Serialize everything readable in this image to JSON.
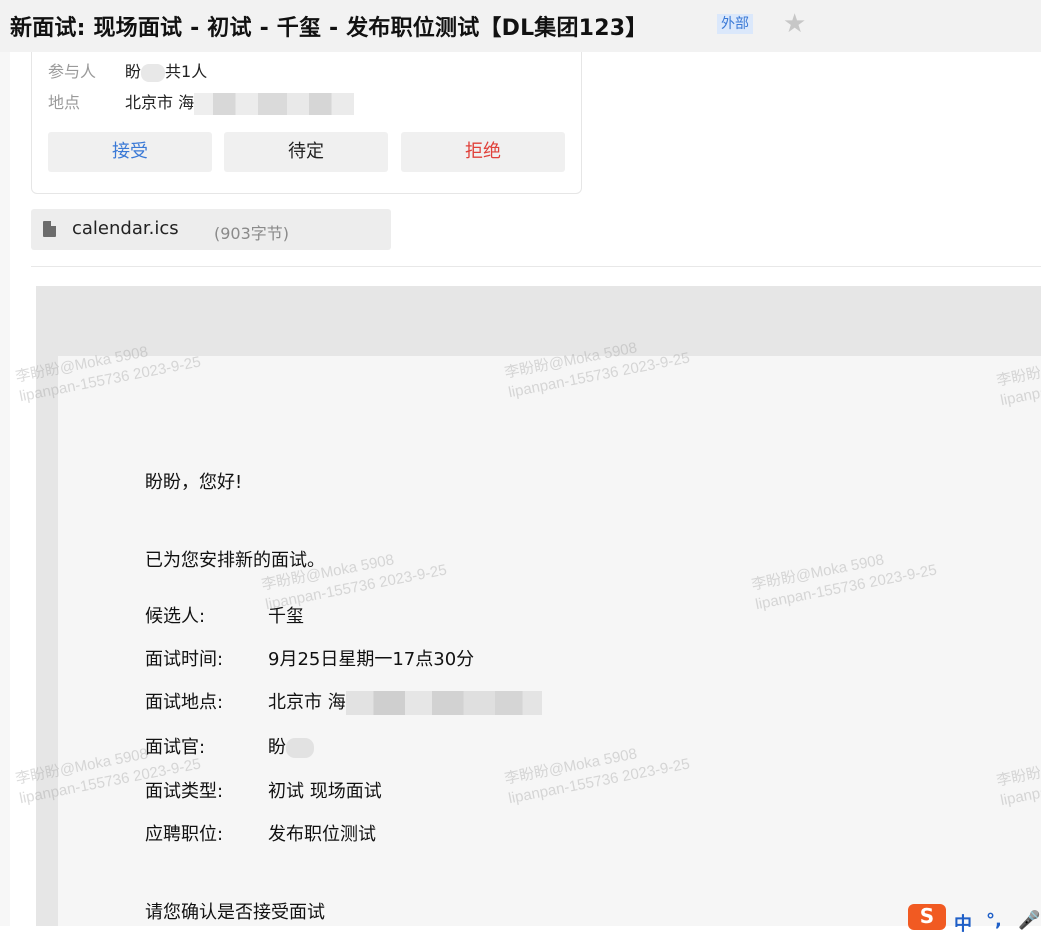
{
  "header": {
    "subject": "新面试: 现场面试 - 初试 - 千玺 - 发布职位测试【DL集团123】",
    "external_badge": "外部",
    "star_icon": "star-icon"
  },
  "invite": {
    "participants_label": "参与人",
    "participants_value_prefix": "盼",
    "participants_value_suffix": "共1人",
    "location_label": "地点",
    "location_value": "北京市 海",
    "accept_label": "接受",
    "tentative_label": "待定",
    "decline_label": "拒绝"
  },
  "attachment": {
    "file_name": "calendar.ics",
    "file_size": "(903字节)",
    "icon": "file-icon"
  },
  "watermark": {
    "line1": "李盼盼@Moka 5908",
    "line2": "lipanpan-155736 2023-9-25"
  },
  "mail": {
    "greeting": "盼盼，您好!",
    "intro": "已为您安排新的面试。",
    "fields": [
      {
        "label": "候选人:",
        "value": "千玺"
      },
      {
        "label": "面试时间:",
        "value": "9月25日星期一17点30分"
      },
      {
        "label": "面试地点:",
        "value": "北京市 海"
      },
      {
        "label": "面试官:",
        "value": "盼"
      },
      {
        "label": "面试类型:",
        "value": "初试 现场面试"
      },
      {
        "label": "应聘职位:",
        "value": "发布职位测试"
      }
    ],
    "confirm": "请您确认是否接受面试"
  },
  "ime": {
    "logo": "S",
    "mode": "中",
    "punct": "°,",
    "mic_icon": "mic-icon"
  },
  "colors": {
    "accept": "#3a79d6",
    "decline": "#e0413a",
    "badge_bg": "#dbe8fb"
  }
}
